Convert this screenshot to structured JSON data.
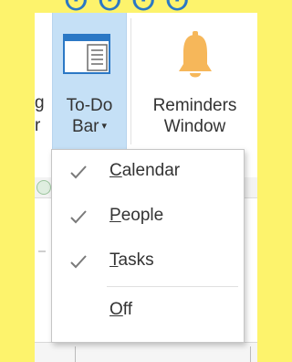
{
  "ribbon": {
    "partial_button": {
      "line1": "g",
      "line2": "r"
    },
    "todo_button": {
      "line1": "To-Do",
      "line2": "Bar",
      "caret": "▾",
      "icon": "todo-bar-icon"
    },
    "reminders_button": {
      "line1": "Reminders",
      "line2": "Window",
      "icon": "bell-icon"
    }
  },
  "menu": {
    "items": [
      {
        "access_key": "C",
        "rest": "alendar",
        "checked": true
      },
      {
        "access_key": "P",
        "rest": "eople",
        "checked": true
      },
      {
        "access_key": "T",
        "rest": "asks",
        "checked": true
      },
      {
        "access_key": "O",
        "rest": "ff",
        "checked": false
      }
    ]
  },
  "colors": {
    "highlight": "#fdf36c",
    "selected_button": "#c5e0f6",
    "bell": "#f6b75a",
    "icon_blue": "#2b78c5"
  }
}
